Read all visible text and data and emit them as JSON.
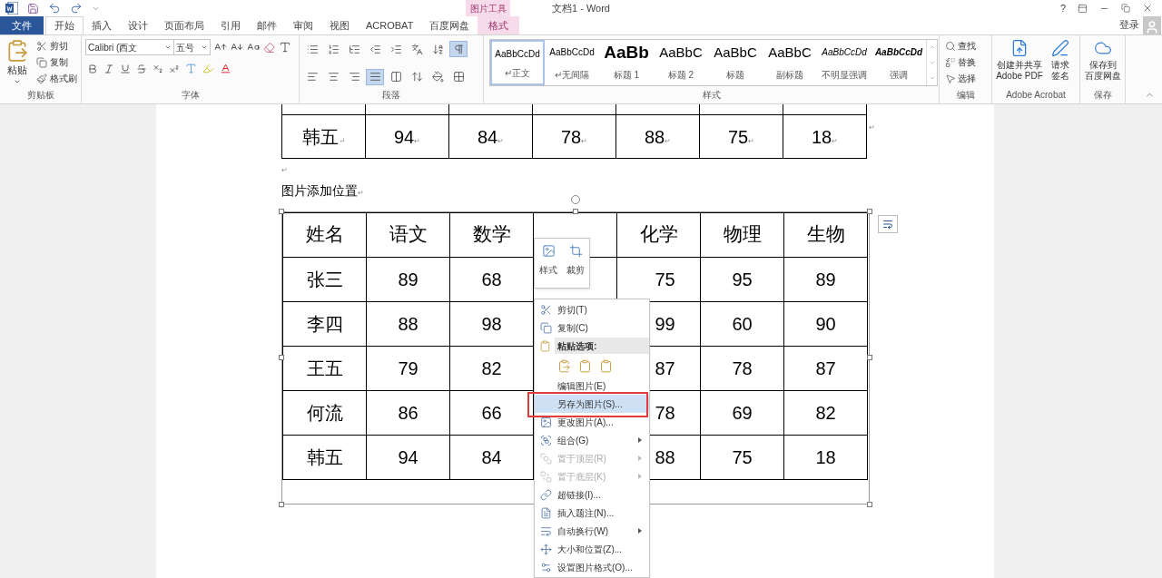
{
  "title_bar": {
    "contextual_group": "图片工具",
    "title": "文档1 - Word",
    "help": "?",
    "sign_in": "登录"
  },
  "tabs": [
    {
      "label": "文件",
      "kind": "file",
      "selected": false
    },
    {
      "label": "开始",
      "kind": "normal",
      "selected": true
    },
    {
      "label": "插入",
      "kind": "normal",
      "selected": false
    },
    {
      "label": "设计",
      "kind": "normal",
      "selected": false
    },
    {
      "label": "页面布局",
      "kind": "normal",
      "selected": false
    },
    {
      "label": "引用",
      "kind": "normal",
      "selected": false
    },
    {
      "label": "邮件",
      "kind": "normal",
      "selected": false
    },
    {
      "label": "审阅",
      "kind": "normal",
      "selected": false
    },
    {
      "label": "视图",
      "kind": "normal",
      "selected": false
    },
    {
      "label": "ACROBAT",
      "kind": "normal",
      "selected": false
    },
    {
      "label": "百度网盘",
      "kind": "normal",
      "selected": false
    },
    {
      "label": "格式",
      "kind": "contextual",
      "selected": false
    }
  ],
  "ribbon": {
    "clipboard": {
      "paste": "粘贴",
      "items": [
        "剪切",
        "复制",
        "格式刷"
      ],
      "label": "剪贴板"
    },
    "font": {
      "font_name": "Calibri (西文",
      "font_size": "五号",
      "label": "字体"
    },
    "paragraph": {
      "tools": [
        {
          "kind": "bullets",
          "selected": false
        },
        {
          "kind": "numbering",
          "selected": false
        },
        {
          "kind": "multilevel",
          "selected": false
        },
        {
          "kind": "outdent",
          "selected": false
        },
        {
          "kind": "indent",
          "selected": false
        },
        {
          "kind": "asian-layout",
          "selected": false
        },
        {
          "kind": "sort",
          "selected": false
        },
        {
          "kind": "show-marks",
          "selected": true
        },
        {
          "kind": "align-left",
          "selected": false
        },
        {
          "kind": "align-center",
          "selected": false
        },
        {
          "kind": "align-right",
          "selected": false
        },
        {
          "kind": "justify",
          "selected": true
        },
        {
          "kind": "distribute",
          "selected": false
        },
        {
          "kind": "line-spacing",
          "selected": false
        },
        {
          "kind": "shading",
          "selected": false
        },
        {
          "kind": "borders",
          "selected": false
        }
      ],
      "label": "段落"
    },
    "styles": {
      "items": [
        {
          "preview": "AaBbCcDd",
          "label": "↵正文",
          "kind": "normal",
          "selected": true
        },
        {
          "preview": "AaBbCcDd",
          "label": "↵无间隔",
          "kind": "normal",
          "selected": false
        },
        {
          "preview": "AaBb",
          "label": "标题 1",
          "kind": "heading1",
          "selected": false
        },
        {
          "preview": "AaBbC",
          "label": "标题 2",
          "kind": "heading2",
          "selected": false
        },
        {
          "preview": "AaBbC",
          "label": "标题",
          "kind": "heading2",
          "selected": false
        },
        {
          "preview": "AaBbC",
          "label": "副标题",
          "kind": "heading2",
          "selected": false
        },
        {
          "preview": "AaBbCcDd",
          "label": "不明显强调",
          "kind": "subtle",
          "selected": false
        },
        {
          "preview": "AaBbCcDd",
          "label": "强调",
          "kind": "emphasis",
          "selected": false
        }
      ],
      "label": "样式"
    },
    "editing": {
      "items": [
        "查找",
        "替换",
        "选择"
      ],
      "label": "编辑"
    },
    "acrobat": {
      "items": [
        [
          "创建并共享",
          "Adobe PDF"
        ],
        [
          "请求",
          "签名"
        ]
      ],
      "label": "Adobe Acrobat"
    },
    "save": {
      "items": [
        [
          "保存到",
          "百度网盘"
        ]
      ],
      "label": "保存"
    }
  },
  "document": {
    "top_table": {
      "row": [
        {
          "text": "韩五",
          "mark": "↵"
        },
        {
          "text": "94",
          "mark": "↵"
        },
        {
          "text": "84",
          "mark": "↵"
        },
        {
          "text": "78",
          "mark": "↵"
        },
        {
          "text": "88",
          "mark": "↵"
        },
        {
          "text": "75",
          "mark": "↵"
        },
        {
          "text": "18",
          "mark": "↵"
        }
      ],
      "row_mark": "↵"
    },
    "empty_paragraph": "↵",
    "caption": "图片添加位置",
    "caption_mark": "↵",
    "picture_table": {
      "columns": [
        "姓名",
        "语文",
        "数学",
        null,
        "化学",
        "物理",
        "生物"
      ],
      "rows": [
        [
          "张三",
          "89",
          "68",
          null,
          "75",
          "95",
          "89"
        ],
        [
          "李四",
          "88",
          "98",
          null,
          "99",
          "60",
          "90"
        ],
        [
          "王五",
          "79",
          "82",
          null,
          "87",
          "78",
          "87"
        ],
        [
          "何流",
          "86",
          "66",
          null,
          "78",
          "69",
          "82"
        ],
        [
          "韩五",
          "94",
          "84",
          null,
          "88",
          "75",
          "18"
        ]
      ]
    }
  },
  "mini_toolbar": [
    "样式",
    "裁剪"
  ],
  "context_menu": [
    {
      "kind": "item",
      "label": "剪切(T)",
      "disabled": false,
      "submenu": false,
      "highlighted": false
    },
    {
      "kind": "item",
      "label": "复制(C)",
      "disabled": false,
      "submenu": false,
      "highlighted": false
    },
    {
      "kind": "header",
      "label": "粘贴选项:"
    },
    {
      "kind": "paste-options"
    },
    {
      "kind": "item",
      "label": "编辑图片(E)",
      "disabled": false,
      "submenu": false,
      "highlighted": false
    },
    {
      "kind": "item",
      "label": "另存为图片(S)...",
      "disabled": false,
      "submenu": false,
      "highlighted": true,
      "annotated": true
    },
    {
      "kind": "item",
      "label": "更改图片(A)...",
      "disabled": false,
      "submenu": false,
      "highlighted": false
    },
    {
      "kind": "item",
      "label": "组合(G)",
      "disabled": false,
      "submenu": true,
      "highlighted": false
    },
    {
      "kind": "item",
      "label": "置于顶层(R)",
      "disabled": true,
      "submenu": true,
      "highlighted": false
    },
    {
      "kind": "item",
      "label": "置于底层(K)",
      "disabled": true,
      "submenu": true,
      "highlighted": false
    },
    {
      "kind": "item",
      "label": "超链接(I)...",
      "disabled": false,
      "submenu": false,
      "highlighted": false
    },
    {
      "kind": "item",
      "label": "插入题注(N)...",
      "disabled": false,
      "submenu": false,
      "highlighted": false
    },
    {
      "kind": "item",
      "label": "自动换行(W)",
      "disabled": false,
      "submenu": true,
      "highlighted": false
    },
    {
      "kind": "item",
      "label": "大小和位置(Z)...",
      "disabled": false,
      "submenu": false,
      "highlighted": false
    },
    {
      "kind": "item",
      "label": "设置图片格式(O)...",
      "disabled": false,
      "submenu": false,
      "highlighted": false
    }
  ]
}
